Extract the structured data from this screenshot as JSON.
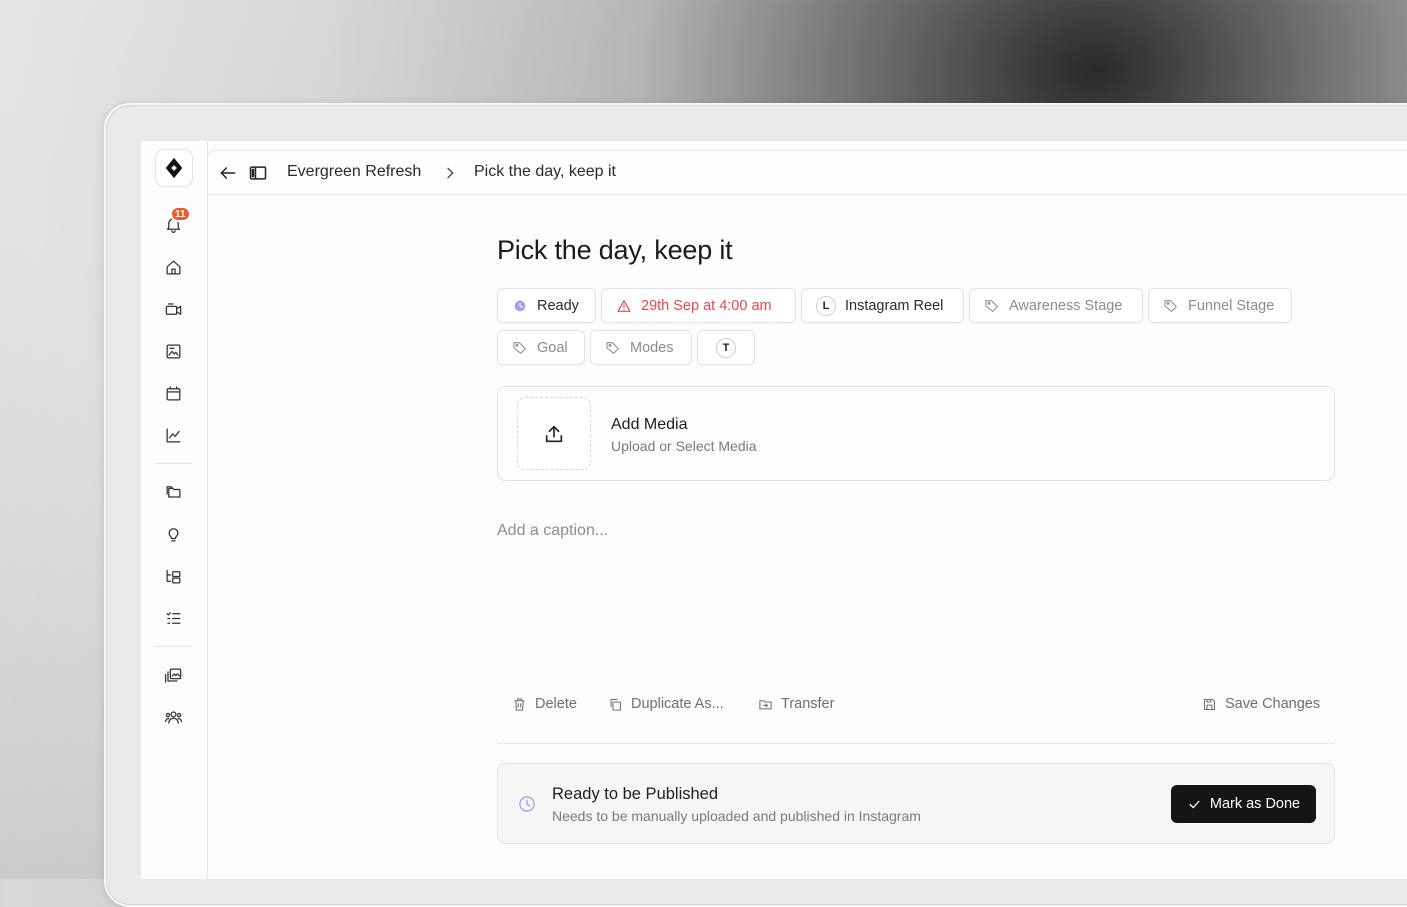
{
  "breadcrumb": {
    "back_icon": "arrow-left-icon",
    "panel_icon": "sidebar-panel-icon",
    "parent": "Evergreen Refresh",
    "current": "Pick the day, keep it"
  },
  "sidebar": {
    "notification_count": "11",
    "icons": [
      "logo-icon",
      "bell-icon",
      "home-icon",
      "video-icon",
      "image-icon",
      "calendar-icon",
      "analytics-icon",
      "folders-icon",
      "lightbulb-icon",
      "hierarchy-icon",
      "checklist-icon",
      "gallery-icon",
      "team-icon"
    ]
  },
  "post": {
    "title": "Pick the day, keep it",
    "chips": {
      "status": "Ready",
      "schedule": "29th Sep at 4:00 am",
      "platform_letter": "L",
      "platform": "Instagram Reel",
      "awareness": "Awareness Stage",
      "funnel": "Funnel Stage",
      "goal": "Goal",
      "modes": "Modes",
      "extra_letter": "T"
    },
    "media": {
      "title": "Add Media",
      "subtitle": "Upload or Select Media"
    },
    "caption_placeholder": "Add a caption..."
  },
  "actions": {
    "delete": "Delete",
    "duplicate": "Duplicate As...",
    "transfer": "Transfer",
    "save": "Save Changes"
  },
  "status_panel": {
    "title": "Ready to be Published",
    "subtitle": "Needs to be manually uploaded and published in Instagram",
    "button": "Mark as Done"
  },
  "colors": {
    "accent_purple": "#a79cf0",
    "alert_red": "#e5484d",
    "badge_orange": "#f05a28",
    "button_dark": "#151515"
  }
}
